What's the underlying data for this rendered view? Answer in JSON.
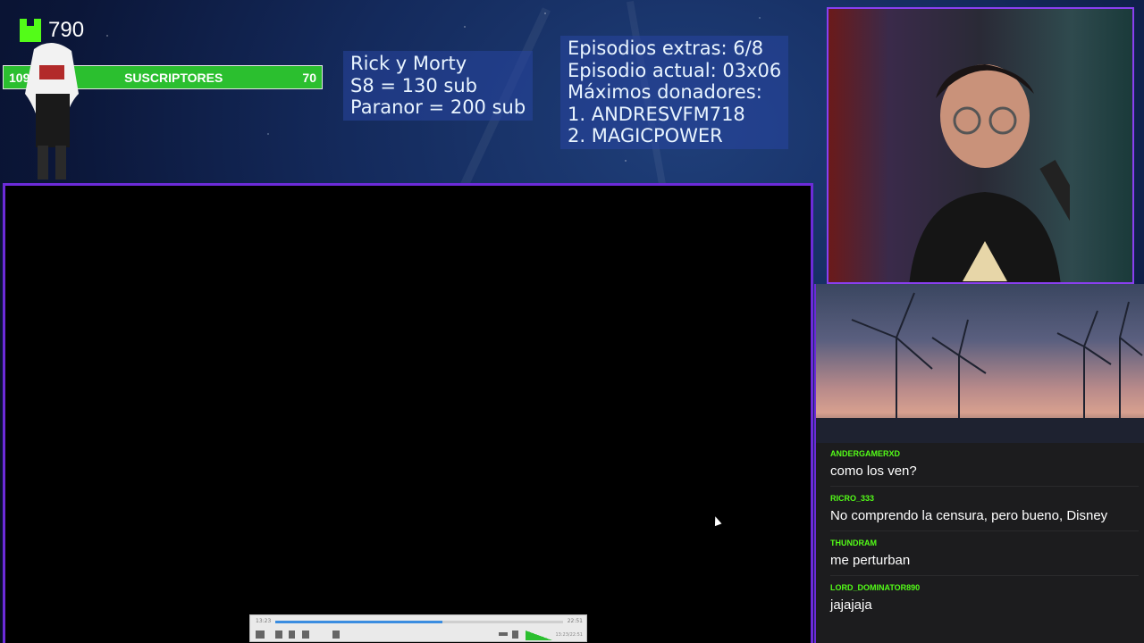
{
  "kick": {
    "count": "790"
  },
  "sub_goal": {
    "left": "109",
    "label": "SUSCRIPTORES",
    "right": "70"
  },
  "info_left": [
    "Rick y Morty",
    "S8 = 130 sub",
    "Paranor = 200 sub"
  ],
  "info_right": [
    "Episodios extras: 6/8",
    "Episodio actual: 03x06",
    "Máximos donadores:",
    "1. ANDRESVFM718",
    "2. MAGICPOWER"
  ],
  "player": {
    "progress": 0.58,
    "elapsed": "13:23",
    "total": "22:51",
    "volume": 1.0,
    "clock": "13:23/22:51"
  },
  "chat": [
    {
      "user": "ANDERGAMERXD",
      "text": "como los ven?"
    },
    {
      "user": "RICRO_333",
      "text": "No comprendo la censura, pero bueno, Disney"
    },
    {
      "user": "THUNDRAM",
      "text": "me perturban"
    },
    {
      "user": "LORD_DOMINATOR890",
      "text": "jajajaja"
    }
  ],
  "colors": {
    "kick_green": "#53fc18",
    "accent_purple": "#6c2bd9",
    "bar_green": "#2bbf2f"
  }
}
